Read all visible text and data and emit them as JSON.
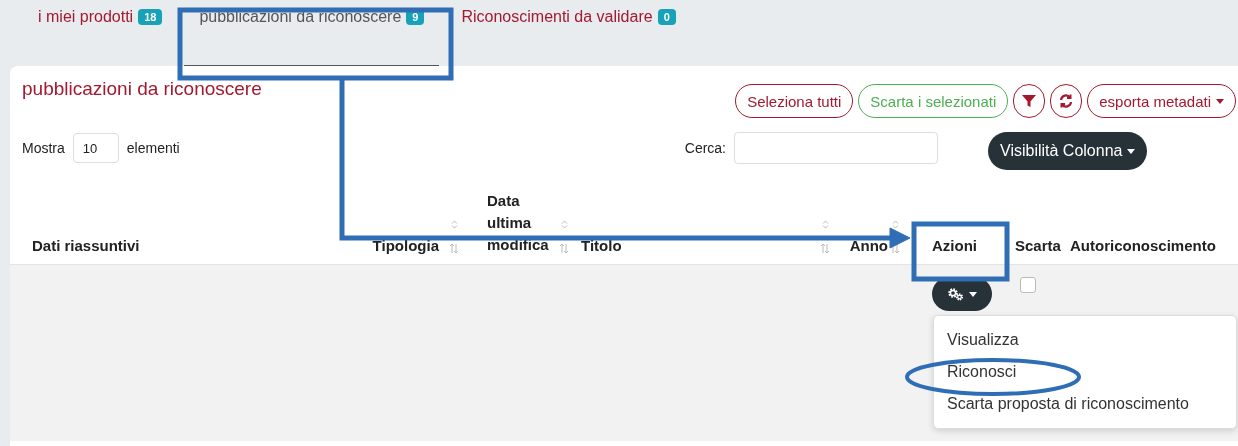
{
  "tabs": [
    {
      "label": "i miei prodotti",
      "badge": "18",
      "selected": false
    },
    {
      "label": "pubblicazioni da riconoscere",
      "badge": "9",
      "selected": true
    },
    {
      "label": "Riconoscimenti da validare",
      "badge": "0",
      "selected": false
    }
  ],
  "panel": {
    "title": "pubblicazioni da riconoscere",
    "actions": [
      {
        "kind": "text",
        "label": "Seleziona tutti",
        "color": "#a3192f"
      },
      {
        "kind": "text",
        "label": "Scarta i selezionati",
        "color": "#4caf50"
      },
      {
        "kind": "filter",
        "color": "#a3192f"
      },
      {
        "kind": "refresh",
        "color": "#a3192f"
      },
      {
        "kind": "dropdown",
        "label": "esporta metadati",
        "color": "#a3192f"
      }
    ],
    "length_menu": {
      "prefix": "Mostra",
      "value": "10",
      "suffix": "elementi"
    },
    "search": {
      "label": "Cerca:"
    },
    "column_visibility": {
      "label": "Visibilità Colonna"
    }
  },
  "table": {
    "columns": [
      {
        "label": "Dati riassuntivi",
        "sortable": false
      },
      {
        "label": "Tipologia",
        "sortable": true
      },
      {
        "label": "Data ultima modifica",
        "sortable": true
      },
      {
        "label": "Titolo",
        "sortable": true
      },
      {
        "label": "Anno",
        "sortable": true
      },
      {
        "label": "Azioni",
        "sortable": false
      },
      {
        "label": "Scarta",
        "sortable": false
      },
      {
        "label": "Autoriconoscimento",
        "sortable": false
      }
    ],
    "rows": [
      {
        "checked": false,
        "menu_open": true,
        "menu": [
          "Visualizza",
          "Riconosci",
          "Scarta proposta di riconoscimento"
        ]
      }
    ]
  }
}
